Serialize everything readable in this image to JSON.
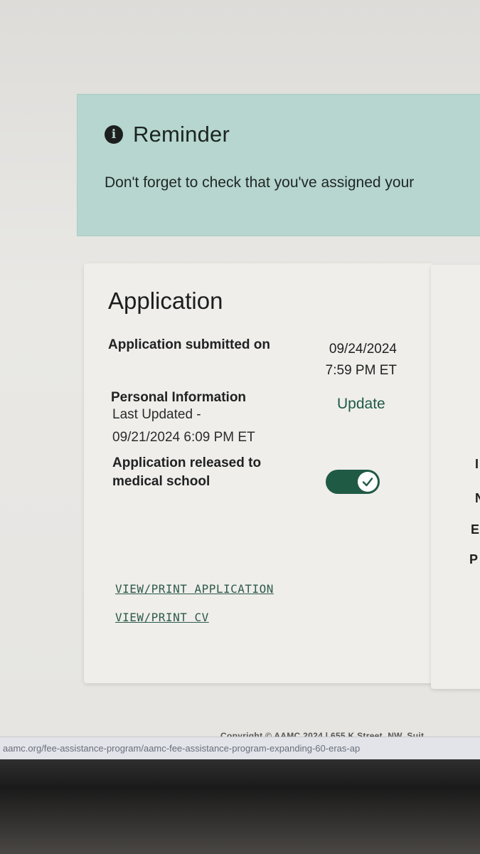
{
  "reminder": {
    "title": "Reminder",
    "text": "Don't forget to check that you've assigned your"
  },
  "application_card": {
    "title": "Application",
    "submitted_label": "Application submitted on",
    "submitted_date": "09/24/2024",
    "submitted_time": "7:59 PM ET",
    "personal_info_label": "Personal Information",
    "last_updated_label": "Last Updated -",
    "last_updated_value": "09/21/2024 6:09 PM ET",
    "update_link": "Update",
    "released_label": "Application released to medical school",
    "released_toggle_on": true,
    "view_print_application": "VIEW/PRINT APPLICATION",
    "view_print_cv": "VIEW/PRINT CV"
  },
  "side_card": {
    "fragments": [
      "I",
      "N",
      "E",
      "P"
    ]
  },
  "footer": {
    "copyright": "Copyright © AAMC 2024 | 655 K Street, NW, Suit"
  },
  "status_bar": {
    "url": "aamc.org/fee-assistance-program/aamc-fee-assistance-program-expanding-60-eras-ap"
  },
  "colors": {
    "reminder_bg": "#b6d6cf",
    "accent_green": "#1f5a45",
    "card_bg": "#efeeeb"
  }
}
